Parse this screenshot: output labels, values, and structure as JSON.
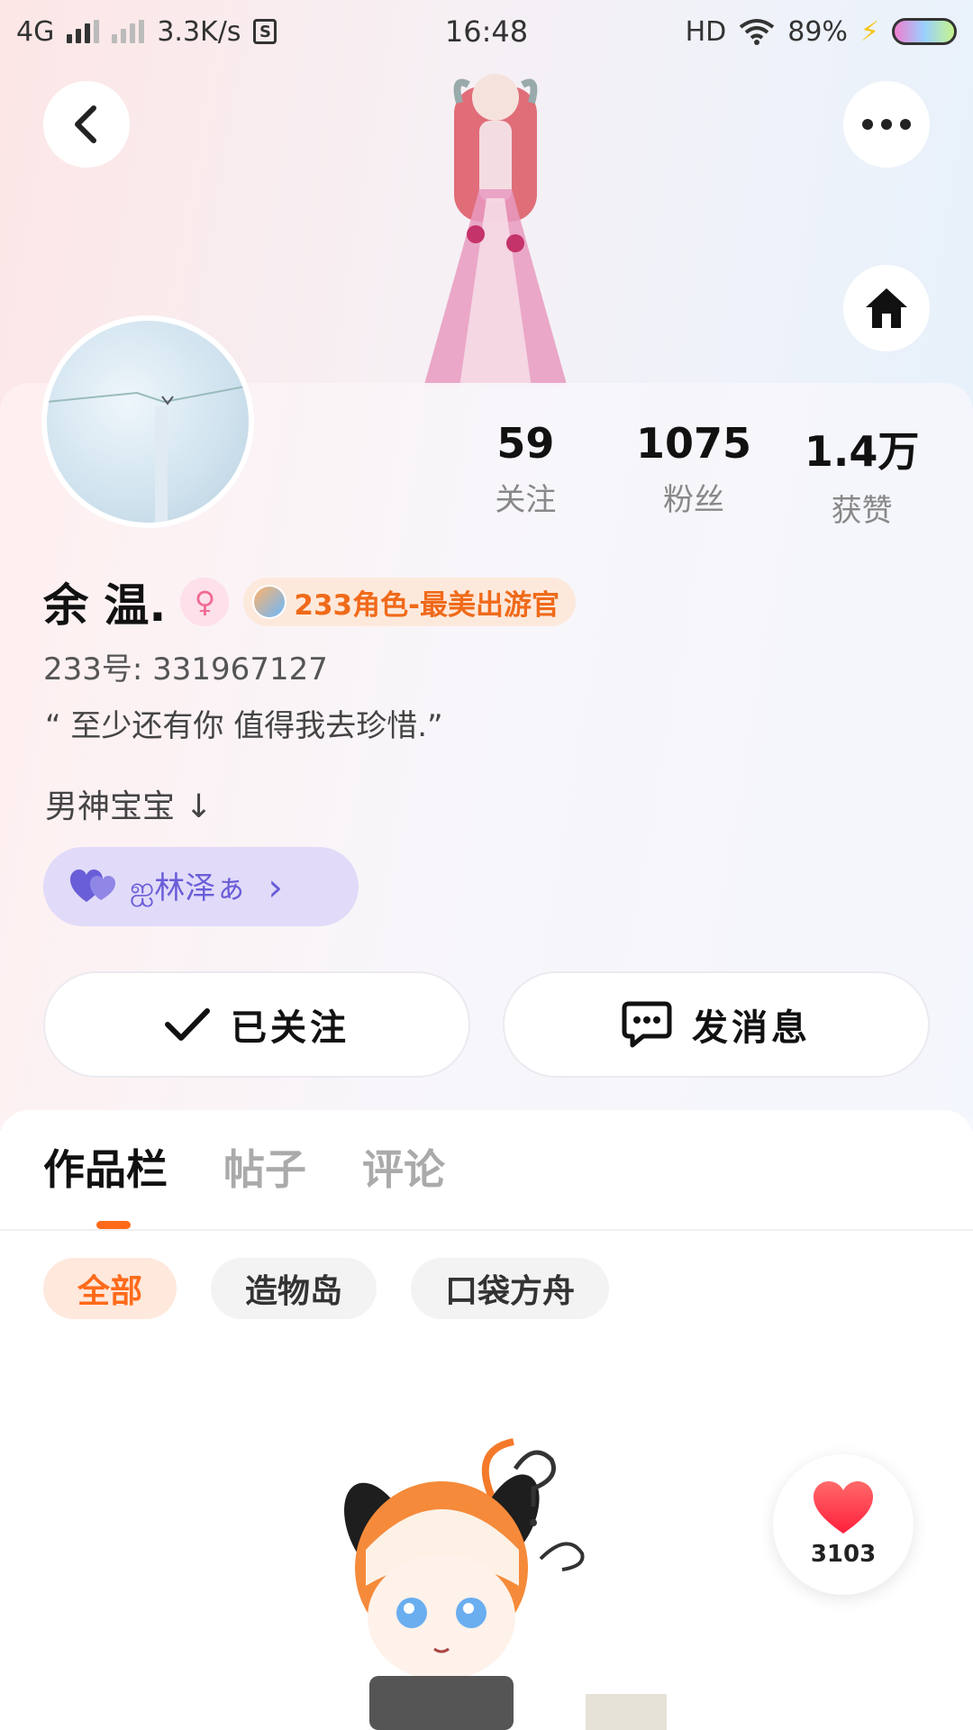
{
  "status_bar": {
    "network": "4G",
    "speed": "3.3K/s",
    "sim_icon": "S",
    "time": "16:48",
    "hd": "HD",
    "battery": "89%"
  },
  "profile": {
    "name": "余 温.",
    "gender_icon": "female-icon",
    "badge": "233角色-最美出游官",
    "uid": "233号: 331967127",
    "bio": "“ 至少还有你 值得我去珍惜.”",
    "tagline": "男神宝宝 ↓",
    "cp_name": "ஐ林泽ぁ",
    "cp_arrow": "›"
  },
  "stats": [
    {
      "value": "59",
      "label": "关注"
    },
    {
      "value": "1075",
      "label": "粉丝"
    },
    {
      "value": "1.4万",
      "label": "获赞"
    }
  ],
  "actions": {
    "follow": "已关注",
    "message": "发消息"
  },
  "tabs": [
    "作品栏",
    "帖子",
    "评论"
  ],
  "chips": [
    "全部",
    "造物岛",
    "口袋方舟"
  ],
  "like_count": "3103",
  "colors": {
    "accent": "#ff6a1a",
    "cp_purple": "#6a5ed8"
  }
}
